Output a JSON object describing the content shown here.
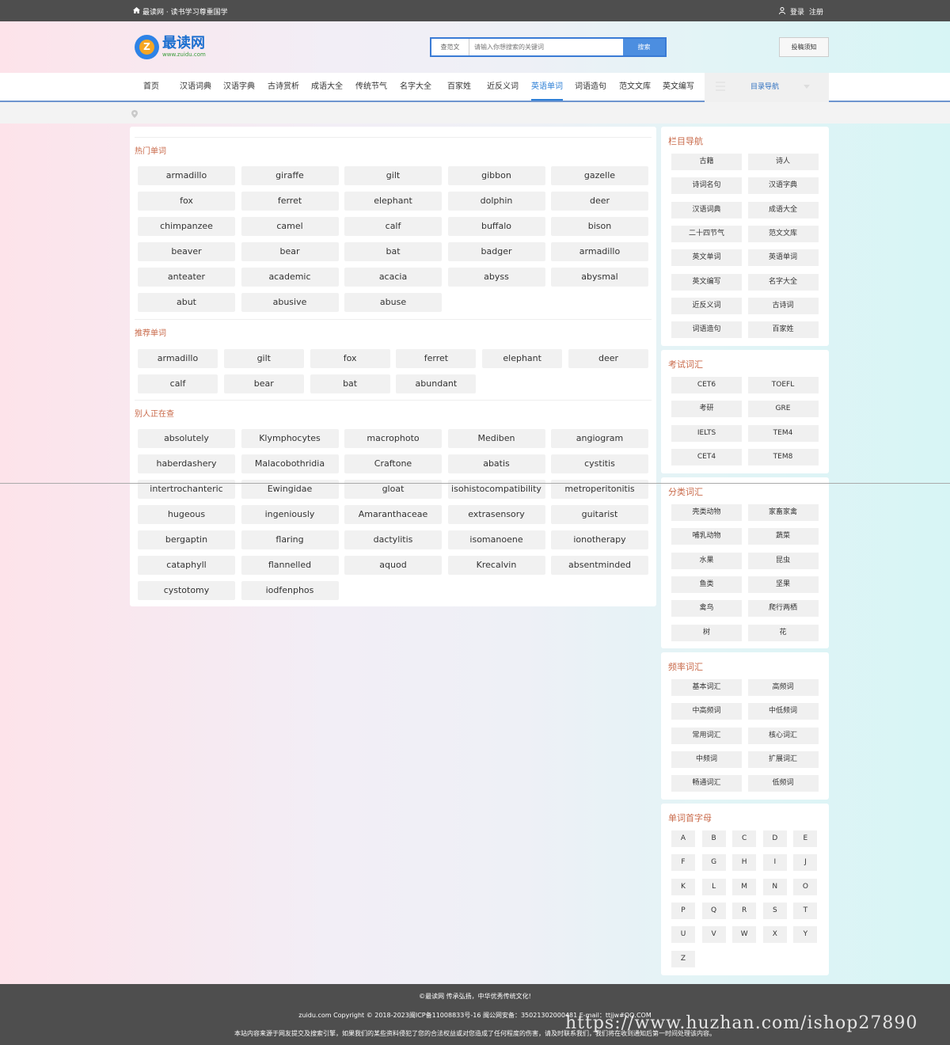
{
  "topbar": {
    "site_slogan": "最读网 · 读书学习尊重国学",
    "login": "登录",
    "register": "注册"
  },
  "logo": {
    "name": "最读网",
    "domain": "www.zuidu.com",
    "badge_letter": "Z"
  },
  "search": {
    "scope": "查范文",
    "placeholder": "请输入你想搜索的关键词",
    "button": "搜索"
  },
  "contribute_label": "投稿须知",
  "nav": {
    "items": [
      "首页",
      "汉语词典",
      "汉语字典",
      "古诗赏析",
      "成语大全",
      "传统节气",
      "名字大全",
      "百家姓",
      "近反义词",
      "英语单词",
      "词语造句",
      "范文文库",
      "英文编写"
    ],
    "active_index": 9,
    "dropdown_label": "目录导航"
  },
  "main": {
    "hot": {
      "title": "热门单词",
      "words": [
        "armadillo",
        "giraffe",
        "gilt",
        "gibbon",
        "gazelle",
        "fox",
        "ferret",
        "elephant",
        "dolphin",
        "deer",
        "chimpanzee",
        "camel",
        "calf",
        "buffalo",
        "bison",
        "beaver",
        "bear",
        "bat",
        "badger",
        "armadillo",
        "anteater",
        "academic",
        "acacia",
        "abyss",
        "abysmal",
        "abut",
        "abusive",
        "abuse"
      ]
    },
    "recommended": {
      "title": "推荐单词",
      "words": [
        "armadillo",
        "gilt",
        "fox",
        "ferret",
        "elephant",
        "deer",
        "calf",
        "bear",
        "bat",
        "abundant"
      ]
    },
    "others": {
      "title": "别人正在查",
      "words": [
        "absolutely",
        "Klymphocytes",
        "macrophoto",
        "Mediben",
        "angiogram",
        "haberdashery",
        "Malacobothridia",
        "Craftone",
        "abatis",
        "cystitis",
        "intertrochanteric",
        "Ewingidae",
        "gloat",
        "isohistocompatibility",
        "metroperitonitis",
        "hugeous",
        "ingeniously",
        "Amaranthaceae",
        "extrasensory",
        "guitarist",
        "bergaptin",
        "flaring",
        "dactylitis",
        "isomanoene",
        "ionotherapy",
        "cataphyll",
        "flannelled",
        "aquod",
        "Krecalvin",
        "absentminded",
        "cystotomy",
        "iodfenphos"
      ]
    }
  },
  "sidebar": {
    "column_nav": {
      "title": "栏目导航",
      "items": [
        "古籍",
        "诗人",
        "诗词名句",
        "汉语字典",
        "汉语词典",
        "成语大全",
        "二十四节气",
        "范文文库",
        "英文单词",
        "英语单词",
        "英文编写",
        "名字大全",
        "近反义词",
        "古诗词",
        "词语造句",
        "百家姓"
      ]
    },
    "exam": {
      "title": "考试词汇",
      "items": [
        "CET6",
        "TOEFL",
        "考研",
        "GRE",
        "IELTS",
        "TEM4",
        "CET4",
        "TEM8"
      ]
    },
    "category": {
      "title": "分类词汇",
      "items": [
        "壳类动物",
        "家畜家禽",
        "哺乳动物",
        "蔬菜",
        "水果",
        "昆虫",
        "鱼类",
        "坚果",
        "禽鸟",
        "爬行两栖",
        "树",
        "花"
      ]
    },
    "frequency": {
      "title": "频率词汇",
      "items": [
        "基本词汇",
        "高频词",
        "中高频词",
        "中低频词",
        "常用词汇",
        "核心词汇",
        "中频词",
        "扩展词汇",
        "畅通词汇",
        "低频词"
      ]
    },
    "letters": {
      "title": "单词首字母",
      "items": [
        "A",
        "B",
        "C",
        "D",
        "E",
        "F",
        "G",
        "H",
        "I",
        "J",
        "K",
        "L",
        "M",
        "N",
        "O",
        "P",
        "Q",
        "R",
        "S",
        "T",
        "U",
        "V",
        "W",
        "X",
        "Y",
        "Z"
      ]
    }
  },
  "footer": {
    "line1": "©最读网 传承弘扬，中华优秀传统文化!",
    "line2": "zuidu.com Copyright © 2018-2023闽ICP备11008833号-16 闽公网安备：35021302000481 E-mail：ttjjw#QQ.COM",
    "line3": "本站内容来源于网友提交及搜索引擎，如果我们的某些资料侵犯了您的合法权益或对您造成了任何程度的伤害，请及时联系我们，我们将在收到通知后第一时间处理该内容。"
  },
  "watermark": "https://www.huzhan.com/ishop27890"
}
